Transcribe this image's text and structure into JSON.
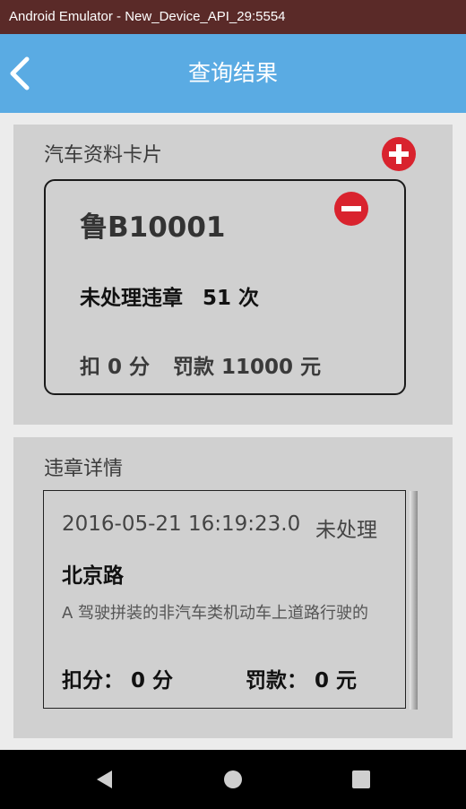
{
  "window": {
    "title": "Android Emulator - New_Device_API_29:5554"
  },
  "app_bar": {
    "title": "查询结果",
    "back_icon": "back-arrow-icon"
  },
  "car_card": {
    "section_title": "汽车资料卡片",
    "add_icon": "add-circle-icon",
    "remove_icon": "remove-circle-icon",
    "plate": "鲁B10001",
    "pending_label": "未处理违章",
    "pending_count": "51 次",
    "points": "扣 0 分",
    "fine": "罚款 11000 元"
  },
  "violation_details": {
    "section_title": "违章详情",
    "items": [
      {
        "time": "2016-05-21 16:19:23.0",
        "status": "未处理",
        "road": "北京路",
        "description": "A 驾驶拼装的非汽车类机动车上道路行驶的",
        "points": "扣分： 0 分",
        "fine": "罚款： 0 元"
      }
    ]
  },
  "nav_bar": {
    "icons": [
      "back-triangle-icon",
      "home-circle-icon",
      "recents-square-icon"
    ]
  },
  "colors": {
    "app_bar": "#5aabe3",
    "window_title": "#5a2a28",
    "icon_red": "#d9232e"
  }
}
